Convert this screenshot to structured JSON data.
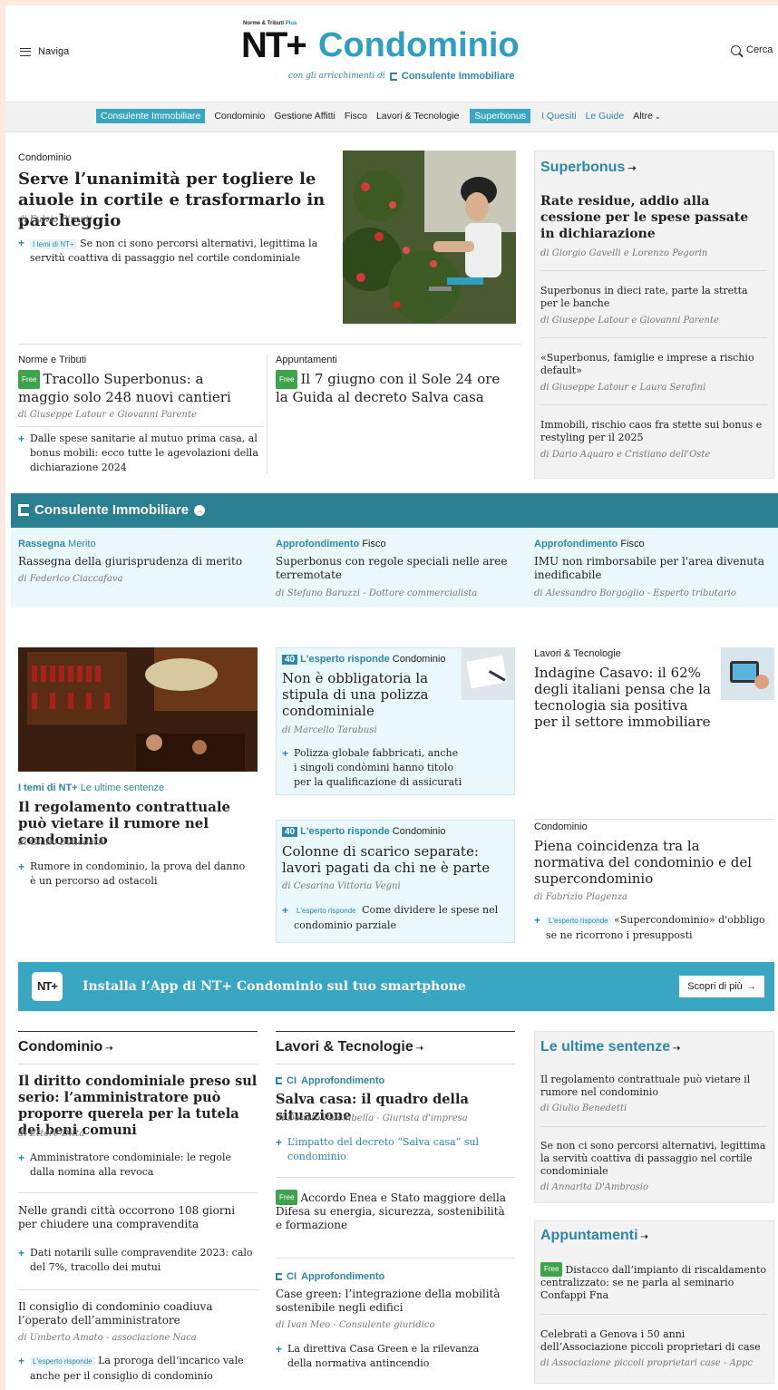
{
  "header": {
    "menu_label": "Naviga",
    "search_label": "Cerca",
    "brand_small": "Norme & Tributi",
    "brand_plus": "Plus",
    "logo_nt": "NT+",
    "logo_title": "Condominio",
    "tagline_prefix": "con gli arricchimenti di",
    "tagline_brand": "Consulente Immobiliare"
  },
  "nav": {
    "items": [
      "Consulente Immobiliare",
      "Condominio",
      "Gestione Affitti",
      "Fisco",
      "Lavori & Tecnologie",
      "Superbonus",
      "I Quesiti",
      "Le Guide",
      "Altre"
    ]
  },
  "lead": {
    "kicker": "Condominio",
    "title": "Serve l’unanimità per togliere le aiuole in cortile e trasformarlo in parcheggio",
    "author": "di Fulvio Pironti",
    "related_tag": "I temi di NT+",
    "related": "Se non ci sono percorsi alternativi, legittima la servitù coattiva di passaggio nel cortile condominiale"
  },
  "sub1": {
    "kicker": "Norme e Tributi",
    "free": "Free",
    "title": "Tracollo Superbonus: a maggio solo 248 nuovi cantieri",
    "author": "di Giuseppe Latour e Giovanni Parente",
    "related": "Dalle spese sanitarie al mutuo prima casa, al bonus mobili: ecco tutte le agevolazioni della dichiarazione 2024"
  },
  "sub2": {
    "kicker": "Appuntamenti",
    "free": "Free",
    "title": "Il 7 giugno con il Sole 24 ore la Guida al decreto Salva casa"
  },
  "superbonus": {
    "heading": "Superbonus",
    "items": [
      {
        "title": "Rate residue, addio alla cessione per le spese passate in dichiarazione",
        "author": "di Giorgio Gavelli e Lorenzo Pegorin"
      },
      {
        "title": "Superbonus in dieci rate, parte la stretta per le banche",
        "author": "di Giuseppe Latour e Giovanni Parente"
      },
      {
        "title": "«Superbonus, famiglie e imprese a rischio default»",
        "author": "di Giuseppe Latour e Laura Serafini"
      },
      {
        "title": "Immobili, rischio caos fra stette sui bonus e restyling per il 2025",
        "author": "di Dario Aquaro e Cristiano dell'Oste"
      }
    ]
  },
  "ci": {
    "heading": "Consulente Immobiliare",
    "cols": [
      {
        "tag": "Rassegna",
        "sub": "Merito",
        "title": "Rassegna della giurisprudenza di merito",
        "author": "di Federico Ciaccafava"
      },
      {
        "tag": "Approfondimento",
        "sub": "Fisco",
        "title": "Superbonus con regole speciali nelle aree terremotate",
        "author": "di Stefano Baruzzi - Dottore commercialista"
      },
      {
        "tag": "Approfondimento",
        "sub": "Fisco",
        "title": "IMU non rimborsabile per l'area divenuta inedificabile",
        "author": "di Alessandro Borgoglio - Esperto tributario"
      }
    ]
  },
  "mid": {
    "a": {
      "tag": "I temi di NT+",
      "sub": "Le ultime sentenze",
      "title": "Il regolamento contrattuale può vietare il rumore nel condominio",
      "author": "di Giulio Benedetti",
      "related": "Rumore in condominio, la prova del danno è un percorso ad ostacoli"
    },
    "b": {
      "badge": "40",
      "tag": "L'esperto risponde",
      "sub": "Condominio",
      "title": "Non è obbligatoria la stipula di una polizza condominiale",
      "author": "di Marcello Tarabusi",
      "related": "Polizza globale fabbricati, anche i singoli condòmini hanno titolo per la qualificazione di assicurati"
    },
    "c": {
      "badge": "40",
      "tag": "L'esperto risponde",
      "sub": "Condominio",
      "title": "Colonne di scarico separate: lavori pagati da chi ne è parte",
      "author": "di Cesarina Vittoria Vegni",
      "related_tag": "L'esperto risponde",
      "related": "Come dividere le spese nel condominio parziale"
    },
    "d": {
      "kicker": "Lavori & Tecnologie",
      "title": "Indagine Casavo: il 62% degli italiani pensa che la tecnologia sia positiva per il settore immobiliare"
    },
    "e": {
      "kicker": "Condominio",
      "title": "Piena coincidenza tra la normativa del condominio e del supercondominio",
      "author": "di Fabrizio Plagenza",
      "related_tag": "L'esperto risponde",
      "related": "«Supercondominio» d'obbligo se ne ricorrono i presupposti"
    }
  },
  "banner": {
    "logo": "NT+",
    "text": "Installa l’App di NT+ Condominio sul tuo smartphone",
    "button": "Scopri di più"
  },
  "col1": {
    "heading": "Condominio",
    "items": [
      {
        "title": "Il diritto condominiale preso sul serio: l’amministratore può proporre querela per la tutela dei beni comuni",
        "author": "di Ettore Ditta",
        "related": "Amministratore condominiale: le regole dalla nomina alla revoca"
      },
      {
        "title": "Nelle grandi città occorrono 108 giorni per chiudere una compravendita",
        "related": "Dati notarili sulle compravendite 2023: calo del 7%, tracollo dei mutui"
      },
      {
        "title": "Il consiglio di condominio coadiuva l’operato dell’amministratore",
        "author": "di Umberto Amato - associazione Naca",
        "related_tag": "L'esperto risponde",
        "related": "La proroga dell’incarico vale anche per il consiglio di condominio"
      }
    ]
  },
  "col2": {
    "heading": "Lavori & Tecnologie",
    "items": [
      {
        "ci": "CI",
        "tag": "Approfondimento",
        "title": "Salva casa: il quadro della situazione",
        "author": "di Donato Palombella - Giurista d'impresa",
        "related": "L’impatto del decreto “Salva casa” sul condominio"
      },
      {
        "free": "Free",
        "title": "Accordo Enea e Stato maggiore della Difesa su energia, sicurezza, sostenibilità e formazione"
      },
      {
        "ci": "CI",
        "tag": "Approfondimento",
        "title": "Case green: l’integrazione della mobilità sostenibile negli edifici",
        "author": "di Ivan Meo - Consulente giuridico",
        "related": "La direttiva Casa Green e la rilevanza della normativa antincendio"
      }
    ]
  },
  "sentenze": {
    "heading": "Le ultime sentenze",
    "items": [
      {
        "title": "Il regolamento contrattuale può vietare il rumore nel condominio",
        "author": "di Giulio Benedetti"
      },
      {
        "title": "Se non ci sono percorsi alternativi, legittima la servitù coattiva di passaggio nel cortile condominiale",
        "author": "di Annarita D'Ambrosio"
      }
    ]
  },
  "appuntamenti": {
    "heading": "Appuntamenti",
    "items": [
      {
        "free": "Free",
        "title": "Distacco dall’impianto di riscaldamento centralizzato: se ne parla al seminario Confappi Fna"
      },
      {
        "title": "Celebrati a Genova i 50 anni dell’Associazione piccoli proprietari di case",
        "author": "di Associazione piccoli proprietari case - Appc"
      }
    ]
  },
  "colors": {
    "accent": "#2e86ab",
    "teal_bar": "#2a7f91",
    "banner": "#3aa7c2",
    "free": "#3fa34d",
    "light_blue": "#eaf8fb"
  }
}
